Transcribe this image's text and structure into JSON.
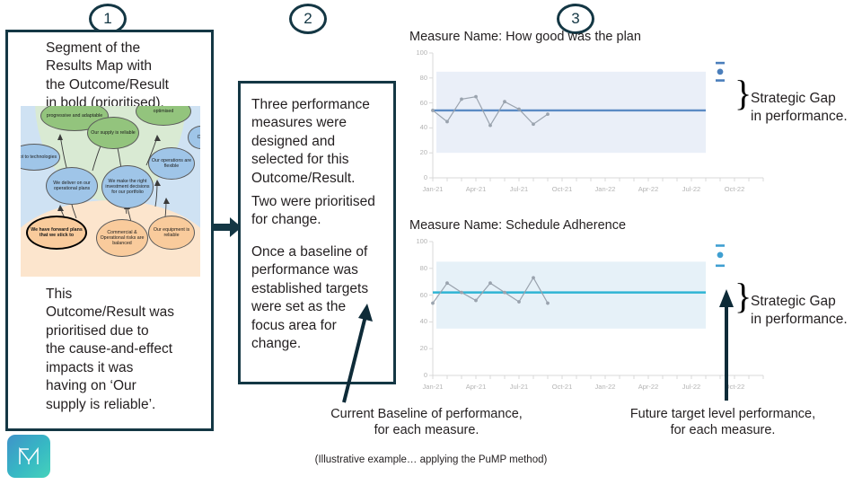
{
  "steps": [
    {
      "number": "1"
    },
    {
      "number": "2"
    },
    {
      "number": "3"
    }
  ],
  "panel1": {
    "top_text": "Segment of the\nResults Map with\nthe Outcome/Result\nin bold (prioritised).",
    "bottom_text": "This\nOutcome/Result was\nprioritised due to\nthe cause-and-effect\nimpacts it was\nhaving on ‘Our\nsupply is reliable’.",
    "map_nodes": [
      {
        "label": "progressive\nand adaptable",
        "type": "green"
      },
      {
        "label": "Our supply\nis reliable",
        "type": "green"
      },
      {
        "label": "optimised",
        "type": "green"
      },
      {
        "label": "adapt to\ntechnologies",
        "type": "blue"
      },
      {
        "label": "We deliver\non our\noperational\nplans",
        "type": "blue"
      },
      {
        "label": "We make the\nright\ninvestment\ndecisions for\nour portfolio",
        "type": "blue"
      },
      {
        "label": "Our\noperations\nare flexible",
        "type": "blue"
      },
      {
        "label": "Our",
        "type": "blue"
      },
      {
        "label": "We have\nforward plans\nthat we stick to",
        "type": "bold"
      },
      {
        "label": "Commercial &\nOperational\nrisks are\nbalanced",
        "type": "orange"
      },
      {
        "label": "Our\nequipment is\nreliable",
        "type": "orange"
      }
    ]
  },
  "panel2": {
    "paragraph1": "Three performance\nmeasures were\ndesigned and\nselected for this\nOutcome/Result.",
    "paragraph2": "Two were prioritised\nfor change.",
    "paragraph3": "Once a baseline of\nperformance was\nestablished targets\nwere set as the\nfocus area for\nchange."
  },
  "gap_annotation": {
    "brace_glyph": "}",
    "label": "Strategic Gap\nin performance."
  },
  "captions": {
    "baseline": "Current Baseline of performance,\nfor each measure.",
    "target": "Future target level performance,\nfor each measure.",
    "footer": "(Illustrative example… applying the PuMP method)"
  },
  "logo": {
    "glyph": "M"
  },
  "colors": {
    "dark_navy": "#143744",
    "band_fill_1": "#eaeff8",
    "band_fill_2": "#e6f1f8",
    "baseline_1": "#5b8bc4",
    "baseline_2": "#2fb4d4",
    "series_line": "#9aa3ae",
    "target_dot": "#4a7ebb",
    "target_dot_2": "#3f9fd1",
    "axis": "#d9d9d9",
    "tick_text": "#b3b3b3"
  },
  "chart_data": [
    {
      "type": "line",
      "title": "Measure Name: How good was the plan",
      "xlabel": "",
      "ylabel": "",
      "ylim": [
        0,
        100
      ],
      "yticks": [
        0,
        20,
        40,
        60,
        80,
        100
      ],
      "xticks": [
        "Jan-21",
        "Apr-21",
        "Jul-21",
        "Oct-21",
        "Jan-22",
        "Apr-22",
        "Jul-22",
        "Oct-22"
      ],
      "x": [
        "Jan-21",
        "Feb-21",
        "Mar-21",
        "Apr-21",
        "May-21",
        "Jun-21",
        "Jul-21",
        "Aug-21",
        "Sep-21"
      ],
      "values": [
        54,
        45,
        63,
        65,
        42,
        61,
        55,
        43,
        51
      ],
      "baseline": 54,
      "band": [
        20,
        85
      ],
      "band_end_x": "Aug-22",
      "target": {
        "x": "Sep-22",
        "value": 85,
        "lower": 78,
        "upper": 92
      },
      "grid": false,
      "legend": "none"
    },
    {
      "type": "line",
      "title": "Measure Name: Schedule  Adherence",
      "xlabel": "",
      "ylabel": "",
      "ylim": [
        0,
        100
      ],
      "yticks": [
        0,
        20,
        40,
        60,
        80,
        100
      ],
      "xticks": [
        "Jan-21",
        "Apr-21",
        "Jul-21",
        "Oct-21",
        "Jan-22",
        "Apr-22",
        "Jul-22",
        "Oct-22"
      ],
      "x": [
        "Jan-21",
        "Feb-21",
        "Mar-21",
        "Apr-21",
        "May-21",
        "Jun-21",
        "Jul-21",
        "Aug-21",
        "Sep-21"
      ],
      "values": [
        54,
        69,
        62,
        56,
        69,
        62,
        55,
        73,
        54
      ],
      "baseline": 62,
      "band": [
        35,
        85
      ],
      "band_end_x": "Aug-22",
      "target": {
        "x": "Sep-22",
        "value": 90,
        "lower": 82,
        "upper": 97
      },
      "grid": false,
      "legend": "none"
    }
  ]
}
